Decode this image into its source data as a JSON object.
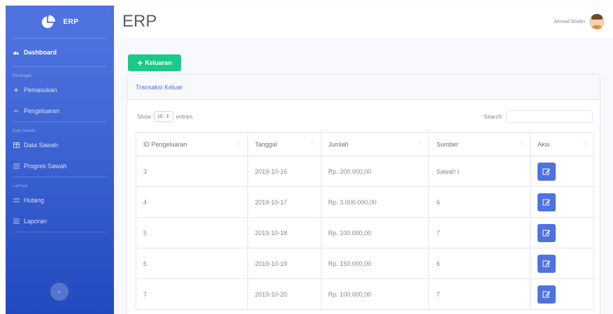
{
  "app": {
    "brand": "ERP",
    "page_title": "ERP"
  },
  "user": {
    "name": "Ahmad Shobri"
  },
  "sidebar": {
    "dashboard": "Dashboard",
    "heading_keuangan": "Keuangan",
    "pemasukan": "Pemasukan",
    "pengeluaran": "Pengeluaran",
    "heading_data": "Data Sawah",
    "data_sawah": "Data Sawah",
    "progres_sawah": "Progres Sawah",
    "heading_lainnya": "Lainnya",
    "hutang": "Hutang",
    "laporan": "Laporan"
  },
  "actions": {
    "keluaran_label": "Keluaran"
  },
  "card": {
    "title": "Transaksi Keluar"
  },
  "table_controls": {
    "show": "Show",
    "length_value": "10",
    "entries": "entries",
    "search_label": "Search:",
    "search_value": ""
  },
  "table": {
    "headers": [
      "ID Pengeluaran",
      "Tanggal",
      "Jumlah",
      "Sumber",
      "Aksi"
    ],
    "rows": [
      [
        "3",
        "2019-10-16",
        "Rp. 200.000,00",
        "Sawah I"
      ],
      [
        "4",
        "2019-10-17",
        "Rp. 3.000.000,00",
        "6"
      ],
      [
        "5",
        "2019-10-18",
        "Rp. 100.000,00",
        "7"
      ],
      [
        "6",
        "2019-10-19",
        "Rp. 150.000,00",
        "6"
      ],
      [
        "7",
        "2019-10-20",
        "Rp. 100.000,00",
        "7"
      ]
    ]
  },
  "colors": {
    "primary": "#4e73df",
    "success": "#1cc88a",
    "sidebar_dark": "#224abe"
  }
}
